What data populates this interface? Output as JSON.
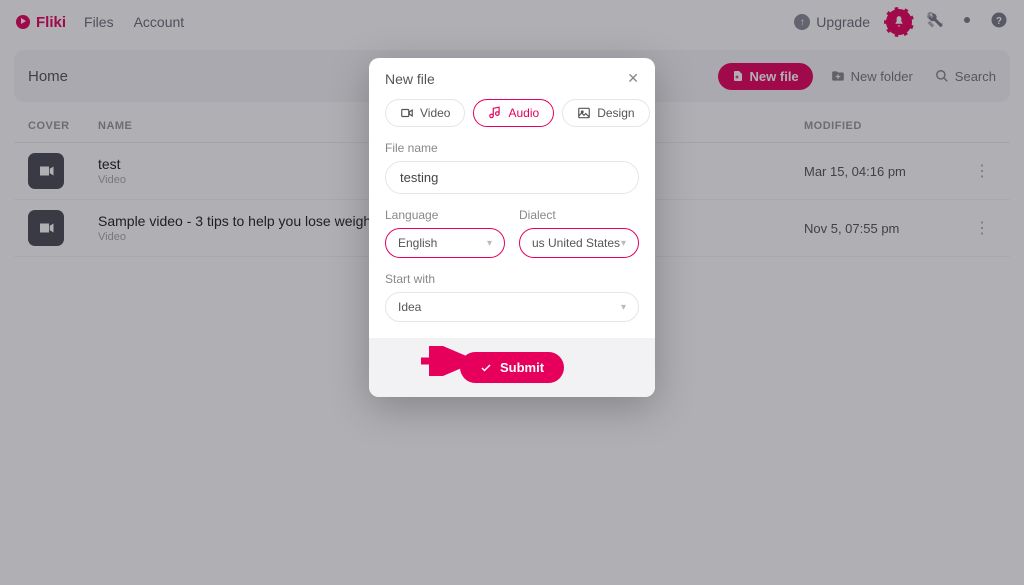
{
  "brand": "Fliki",
  "nav": {
    "files": "Files",
    "account": "Account",
    "upgrade": "Upgrade"
  },
  "topbar": {
    "breadcrumb": "Home",
    "new_file": "New file",
    "new_folder": "New folder",
    "search": "Search"
  },
  "table": {
    "headers": {
      "cover": "COVER",
      "name": "NAME",
      "modified": "MODIFIED"
    },
    "rows": [
      {
        "title": "test",
        "subtitle": "Video",
        "modified": "Mar 15, 04:16 pm"
      },
      {
        "title": "Sample video - 3 tips to help you lose weight",
        "subtitle": "Video",
        "modified": "Nov 5, 07:55 pm"
      }
    ]
  },
  "modal": {
    "title": "New file",
    "tabs": {
      "video": "Video",
      "audio": "Audio",
      "design": "Design"
    },
    "file_name_label": "File name",
    "file_name_value": "testing",
    "language_label": "Language",
    "language_value": "English",
    "dialect_label": "Dialect",
    "dialect_value": "us United States",
    "start_with_label": "Start with",
    "start_with_value": "Idea",
    "submit": "Submit"
  },
  "colors": {
    "accent": "#e6005c"
  }
}
